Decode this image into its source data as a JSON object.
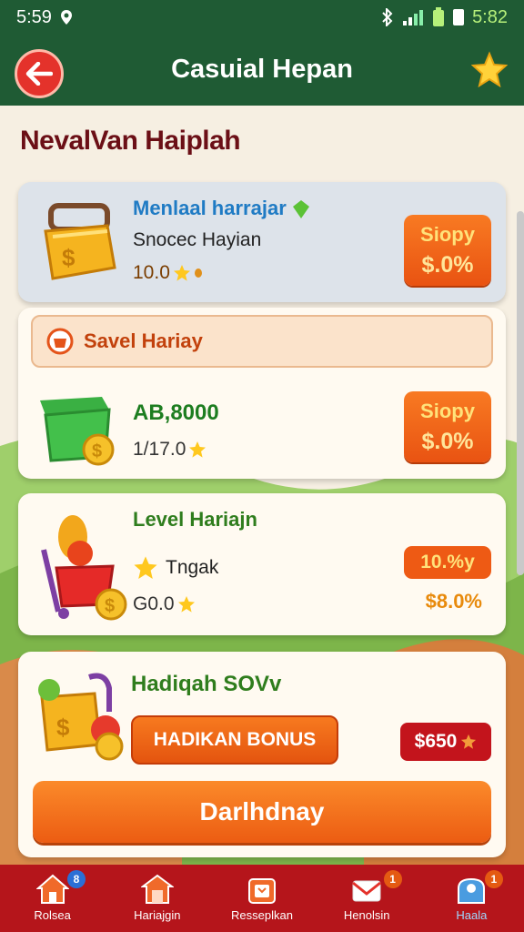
{
  "status_bar": {
    "time": "5:59",
    "right_time": "5:82"
  },
  "header": {
    "title": "Casuial Hepan"
  },
  "page_heading": "NevalVan Haiplah",
  "offer1": {
    "title": "Menlaal harrajar",
    "subtitle": "Snocec Hayian",
    "price": "10.0",
    "buy_label": "Siopy",
    "buy_value": "$.0%"
  },
  "offer2": {
    "banner_label": "Savel Hariay",
    "title": "AB,8000",
    "price": "1/17.0",
    "buy_label": "Siopy",
    "buy_value": "$.0%"
  },
  "offer3": {
    "title": "Level Hariajn",
    "subtitle": "Tngak",
    "price": "G0.0",
    "pill_label": "10.%y",
    "value": "$8.0%"
  },
  "offer4": {
    "title": "Hadiqah SOVv",
    "bonus_label": "HADIKAN BONUS",
    "price": "$650",
    "cta_label": "Darlhdnay"
  },
  "bottom_nav": {
    "items": [
      {
        "label": "Rolsea",
        "icon": "home-icon",
        "badge": "8",
        "badge_color": "#2b6fd6"
      },
      {
        "label": "Hariajgin",
        "icon": "shop-icon"
      },
      {
        "label": "Resseplkan",
        "icon": "gift-icon"
      },
      {
        "label": "Henolsin",
        "icon": "mail-icon",
        "badge": "1",
        "badge_color": "#e45a12"
      },
      {
        "label": "Haala",
        "icon": "profile-icon",
        "badge": "1",
        "badge_color": "#e45a12",
        "active": true
      }
    ]
  },
  "colors": {
    "header_bg": "#1f5b34",
    "nav_bg": "#b5151b",
    "accent_orange": "#ec5c12"
  }
}
